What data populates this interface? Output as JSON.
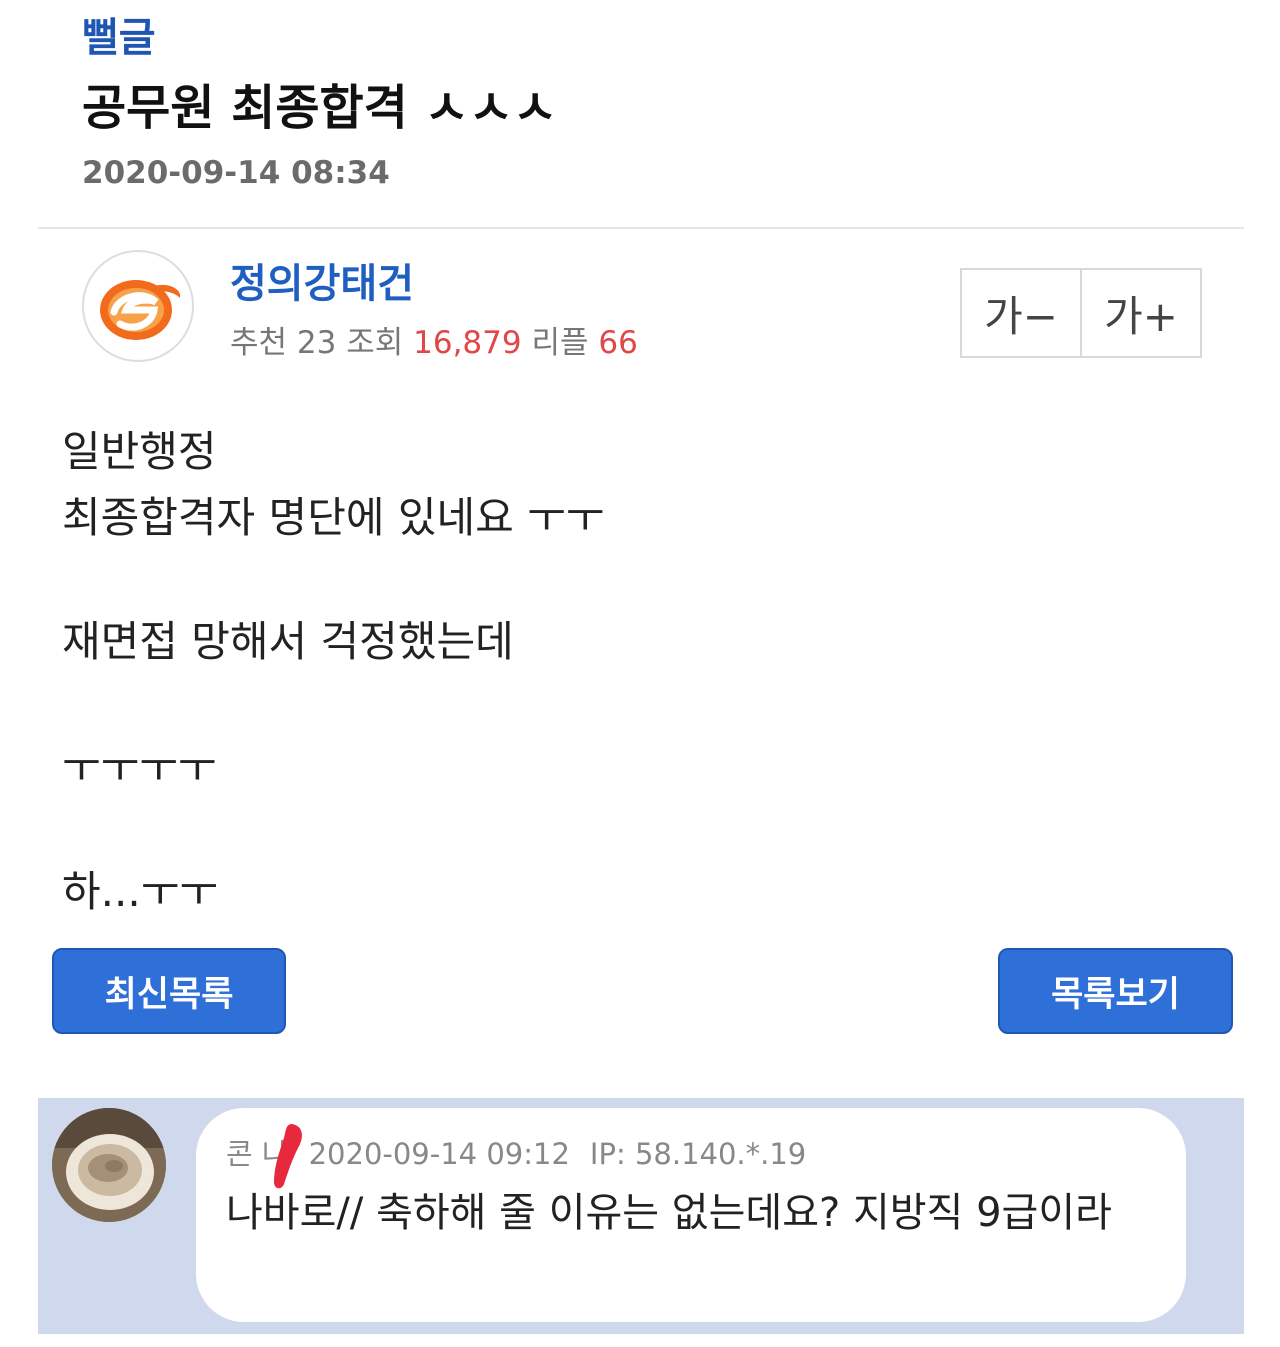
{
  "post": {
    "category": "뻘글",
    "title": "공무원 최종합격 ㅅㅅㅅ",
    "date": "2020-09-14 08:34"
  },
  "author": {
    "name": "정의강태건",
    "avatar_icon": "orange-e-logo-icon",
    "recommend_label": "추천",
    "recommend_count": "23",
    "views_label": "조회",
    "views_count": "16,879",
    "replies_label": "리플",
    "replies_count": "66"
  },
  "font_controls": {
    "decrease_label": "가−",
    "increase_label": "가+"
  },
  "body": {
    "lines": [
      "일반행정",
      "최종합격자 명단에 있네요 ㅜㅜ",
      "재면접 망해서 걱정했는데",
      "ㅜㅜㅜㅜ",
      "하...ㅜㅜ"
    ]
  },
  "buttons": {
    "latest_list": "최신목록",
    "view_list": "목록보기"
  },
  "comment": {
    "nickname": "콘 냐",
    "time": "2020-09-14 09:12",
    "ip": "IP: 58.140.*.19",
    "text": "나바로// 축하해 줄 이유는 없는데요? 지방직 9급이라",
    "avatar_icon": "coffee-cup-photo-icon"
  },
  "colors": {
    "accent_blue": "#2f6fd8",
    "author_blue": "#1f5fc0",
    "category_blue": "#1f55b5",
    "count_red": "#e04848",
    "comment_background": "#cfd8ec",
    "redaction_red": "#e8283c"
  }
}
